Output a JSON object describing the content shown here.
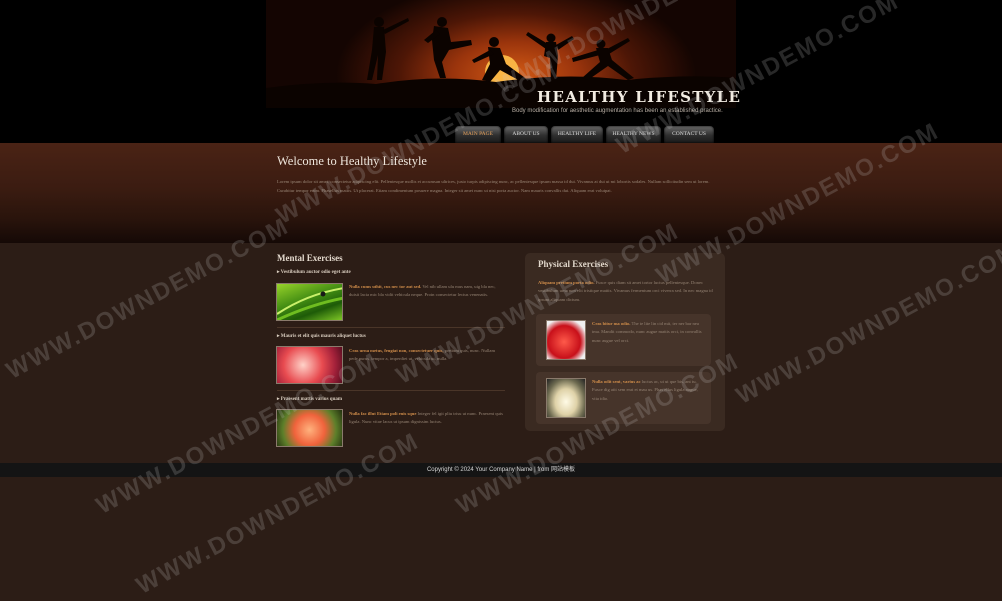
{
  "header": {
    "title": "HEALTHY LIFESTYLE",
    "slogan": "Body modification for aesthetic augmentation has been an established practice."
  },
  "nav": [
    {
      "label": "MAIN PAGE",
      "active": true
    },
    {
      "label": "ABOUT US",
      "active": false
    },
    {
      "label": "HEALTHY LIFE",
      "active": false
    },
    {
      "label": "HEALTHY NEWS",
      "active": false
    },
    {
      "label": "CONTACT US",
      "active": false
    }
  ],
  "welcome": {
    "title": "Welcome to Healthy Lifestyle",
    "text": "Lorem ipsum dolor sit amet, consectetur adipiscing elit. Pellentesque mollis et accumsan ultrices, justo turpis adipiscing nunc, ac pellentesque ipsum massa id dui. Vivamus at dui ut mi lobortis sodales. Nullam sollicitudin sem ut lorem. Curabitur tempor enim. Phasellus mattis. Ut placerat. Etiam condimentum posuere magna. Integer sit amet nunc ut nisi porta auctor. Nam mauris convallis dui. Aliquam erat volutpat."
  },
  "mental": {
    "title": "Mental Exercises",
    "items": [
      {
        "heading": "Vestibulum auctor odio eget ante",
        "highlight": "Nulla cums uthit, cus nec tor aut sed.",
        "text": " Vel nib ullam ulu mus nam, uig bla nec, duisit lacia mic bla vidit vehicula neque. Proin consectetur lectus venenatis."
      },
      {
        "heading": "Mauris et elit quis mauris aliquet luctus",
        "highlight": "Cras urna metus, feugiat non, consectetuer quis,",
        "text": " pretium quis, nunc. Nullam pede purus, tempor a, imperdiet ut, vehicula ut, nulla."
      },
      {
        "heading": "Praesent mattis varius quam",
        "highlight": "Nulla fac illut Etiam poli enis sque",
        "text": " Integer fel igit pliu trisu ut nunc. Praesent quis ligula. Nunc vitae lacus ut ipsum dignissim luctus."
      }
    ]
  },
  "physical": {
    "title": "Physical Exercises",
    "intro_highlight": "Aliquam pretium porta odio.",
    "intro_text": " Fusce quis diam sit amet tortor luctus pellentesque. Donec vestibulum urna non elit tristique mattis. Vivamus fermentum orci viverra sed. In nec magna id ipsum aliquam dictum.",
    "items": [
      {
        "highlight": "Cras bitur ma odio.",
        "text": " The te lite lin cid mit, ter ner bar nea ima. Mandit commodo, nunc augue mattis orci, in convallis nunc augue vel orci."
      },
      {
        "highlight": "Nulla odit sent, varius ac",
        "text": " luctus ac, ut ut que bis, ant tu. Fusce dig atit sem erat et mau us. Phas ellus ligula augue, vita idio."
      }
    ]
  },
  "footer": {
    "text": "Copyright © 2024 Your Company Name | from 网站模板"
  },
  "watermark": {
    "text": "WWW.DOWNDEMO.COM"
  },
  "icons": {
    "bullet": "triangle-right-icon"
  },
  "colors": {
    "accent": "#d08d4a",
    "background": "#2c1d16",
    "footer": "#141414"
  }
}
